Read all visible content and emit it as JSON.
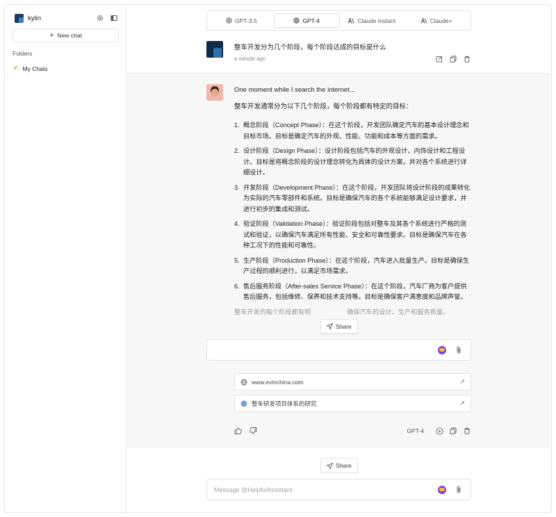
{
  "sidebar": {
    "user_name": "kylin",
    "new_chat_label": "New chat",
    "folders_label": "Folders",
    "my_chats_label": "My Chats"
  },
  "models": {
    "tabs": [
      {
        "label": "GPT-3.5",
        "active": false,
        "icon": "openai-icon"
      },
      {
        "label": "GPT-4",
        "active": true,
        "icon": "openai-icon"
      },
      {
        "label": "Claude Instant",
        "active": false,
        "icon": "anthropic-icon"
      },
      {
        "label": "Claude+",
        "active": false,
        "icon": "anthropic-icon"
      }
    ]
  },
  "user_message": {
    "text": "整车开发分为几个阶段，每个阶段达成的目标是什么",
    "time": "a minute ago"
  },
  "bot_message": {
    "searching": "One moment while I search the internet...",
    "intro": "整车开发通常分为以下几个阶段，每个阶段都有特定的目标：",
    "items": [
      {
        "num": "1.",
        "text": "概念阶段（Concept Phase）：在这个阶段，开发团队确定汽车的基本设计理念和目标市场。目标是确定汽车的外观、性能、功能和成本等方面的需求。"
      },
      {
        "num": "2.",
        "text": "设计阶段（Design Phase）：设计阶段包括汽车的外观设计、内饰设计和工程设计。目标是将概念阶段的设计理念转化为具体的设计方案，并对各个系统进行详细设计。"
      },
      {
        "num": "3.",
        "text": "开发阶段（Development Phase）：在这个阶段，开发团队将设计阶段的成果转化为实际的汽车零部件和系统。目标是确保汽车的各个系统能够满足设计要求，并进行初步的集成和测试。"
      },
      {
        "num": "4.",
        "text": "验证阶段（Validation Phase）：验证阶段包括对整车及其各个系统进行严格的测试和验证，以确保汽车满足所有性能、安全和可靠性要求。目标是确保汽车在各种工况下的性能和可靠性。"
      },
      {
        "num": "5.",
        "text": "生产阶段（Production Phase）：在这个阶段，汽车进入批量生产。目标是确保生产过程的顺利进行，以满足市场需求。"
      },
      {
        "num": "6.",
        "text": "售后服务阶段（After-sales Service Phase）：在这个阶段，汽车厂商为客户提供售后服务，包括维修、保养和技术支持等。目标是确保客户满意度和品牌声誉。"
      }
    ],
    "conclusion_start": "整车开发的每个阶段都有明",
    "conclusion_end": "确保汽车的设计、生产和服务质量。",
    "model_name": "GPT-4"
  },
  "share_label": "Share",
  "mid_input": {
    "value": "",
    "placeholder": ""
  },
  "sources": [
    {
      "label": "www.evinchina.com",
      "icon": "globe-icon"
    },
    {
      "label": "整车研发项目体系的研究",
      "icon": "doc-icon"
    }
  ],
  "bottom_input": {
    "placeholder": "Message @HelpfulAssistant"
  }
}
